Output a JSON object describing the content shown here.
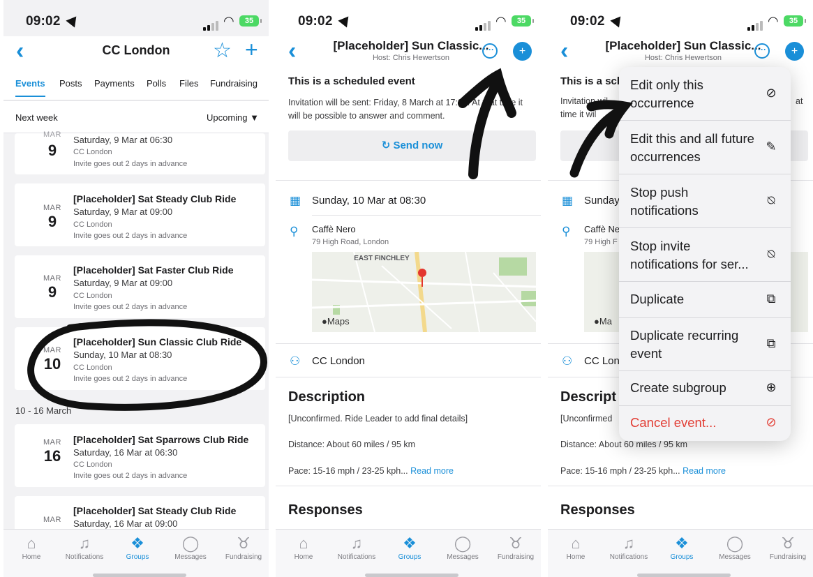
{
  "status": {
    "time": "09:02",
    "battery": "35"
  },
  "tabbar": {
    "items": [
      {
        "label": "Home",
        "icon": "home-icon",
        "glyph": "⌂"
      },
      {
        "label": "Notifications",
        "icon": "bell-icon",
        "glyph": "🔔"
      },
      {
        "label": "Groups",
        "icon": "groups-icon",
        "glyph": "♺"
      },
      {
        "label": "Messages",
        "icon": "chat-bubble-icon",
        "glyph": "◯"
      },
      {
        "label": "Fundraising",
        "icon": "piggy-bank-icon",
        "glyph": "♉"
      }
    ],
    "active": "Groups"
  },
  "screen1": {
    "title": "CC London",
    "tabs": [
      "Events",
      "Posts",
      "Payments",
      "Polls",
      "Files",
      "Fundraising"
    ],
    "filter_label": "Next week",
    "filter_dropdown": "Upcoming ▼",
    "section_2": "10 - 16 March",
    "events": [
      {
        "month": "MAR",
        "day": "9",
        "title": "",
        "when": "Saturday, 9 Mar at 06:30",
        "group": "CC London",
        "invite": "Invite goes out 2 days in advance"
      },
      {
        "month": "MAR",
        "day": "9",
        "title": "[Placeholder] Sat Steady Club Ride",
        "when": "Saturday, 9 Mar at 09:00",
        "group": "CC London",
        "invite": "Invite goes out 2 days in advance"
      },
      {
        "month": "MAR",
        "day": "9",
        "title": "[Placeholder] Sat Faster Club Ride",
        "when": "Saturday, 9 Mar at 09:00",
        "group": "CC London",
        "invite": "Invite goes out 2 days in advance"
      },
      {
        "month": "MAR",
        "day": "10",
        "title": "[Placeholder] Sun Classic Club Ride",
        "when": "Sunday, 10 Mar at 08:30",
        "group": "CC London",
        "invite": "Invite goes out 2 days in advance"
      },
      {
        "month": "MAR",
        "day": "16",
        "title": "[Placeholder] Sat Sparrows Club Ride",
        "when": "Saturday, 16 Mar at 06:30",
        "group": "CC London",
        "invite": "Invite goes out 2 days in advance"
      },
      {
        "month": "MAR",
        "day": "",
        "title": "[Placeholder] Sat Steady Club Ride",
        "when": "Saturday, 16 Mar at 09:00",
        "group": "",
        "invite": ""
      }
    ]
  },
  "event": {
    "title": "[Placeholder] Sun Classic...",
    "host": "Host: Chris Hewertson",
    "scheduled": "This is a scheduled event",
    "invitation": "Invitation will be sent: Friday, 8 March at 17:00. At that time it will be possible to answer and comment.",
    "send_now": "Send now",
    "date": "Sunday, 10 Mar at 08:30",
    "venue": "Caffè Nero",
    "address": "79 High Road, London",
    "map_label": "EAST FINCHLEY",
    "map_logo": "Maps",
    "group": "CC London",
    "description_heading": "Description",
    "desc_line1": "[Unconfirmed. Ride Leader to add final details]",
    "desc_line2": "Distance: About 60 miles / 95 km",
    "desc_line3": "Pace: 15-16 mph / 23-25 kph...",
    "read_more": "Read more",
    "responses_heading": "Responses"
  },
  "screen3": {
    "scheduled_clip": "This is a sch",
    "invitation_clip_1": "Invitation wil",
    "invitation_clip_2": "time it wil",
    "invitation_tail": "at",
    "date_clip": "Sunday",
    "venue_clip": "Caffè Ne",
    "address_clip": "79 High F",
    "map_logo_clip": "Ma",
    "group_clip": "CC Lon",
    "description_clip": "Descript",
    "desc_line1_clip": "[Unconfirmed",
    "desc_line2": "Distance: About 60 miles / 95 km",
    "desc_line3": "Pace: 15-16 mph / 23-25 kph...",
    "read_more": "Read more",
    "responses_heading": "Responses"
  },
  "menu": {
    "items": [
      {
        "label": "Edit only this occurrence",
        "icon": "slash-circle-icon",
        "glyph": "⊘"
      },
      {
        "label": "Edit this and all future occurrences",
        "icon": "edit-recurring-icon",
        "glyph": "✎"
      },
      {
        "label": "Stop push notifications",
        "icon": "bell-slash-icon",
        "glyph": "🔕"
      },
      {
        "label": "Stop invite notifications for ser...",
        "icon": "bell-slash-icon",
        "glyph": "🔕"
      },
      {
        "label": "Duplicate",
        "icon": "duplicate-icon",
        "glyph": "⧉"
      },
      {
        "label": "Duplicate recurring event",
        "icon": "duplicate-icon",
        "glyph": "⧉"
      },
      {
        "label": "Create subgroup",
        "icon": "plus-circle-icon",
        "glyph": "⊕"
      },
      {
        "label": "Cancel event...",
        "icon": "prohibited-icon",
        "glyph": "⃠"
      }
    ]
  },
  "colors": {
    "accent": "#1a8fd8",
    "danger": "#e23c33",
    "annotation": "#111111"
  }
}
